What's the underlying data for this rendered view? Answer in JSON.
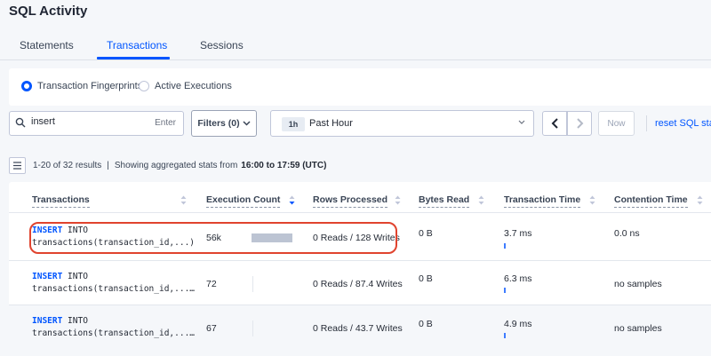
{
  "page": {
    "title": "SQL Activity"
  },
  "tabs": [
    {
      "label": "Statements",
      "active": false
    },
    {
      "label": "Transactions",
      "active": true
    },
    {
      "label": "Sessions",
      "active": false
    }
  ],
  "view_options": [
    {
      "label": "Transaction Fingerprints",
      "selected": true
    },
    {
      "label": "Active Executions",
      "selected": false
    }
  ],
  "search": {
    "value": "insert",
    "enter_label": "Enter"
  },
  "filters": {
    "label": "Filters (0)"
  },
  "time_range": {
    "badge": "1h",
    "label": "Past Hour"
  },
  "nav": {
    "now_label": "Now",
    "reset_label": "reset SQL stats"
  },
  "results": {
    "count_text": "1-20 of 32 results",
    "separator": "|",
    "prefix": "Showing aggregated stats from",
    "range": "16:00 to 17:59 (UTC)"
  },
  "table": {
    "columns": [
      "Transactions",
      "Execution Count",
      "Rows Processed",
      "Bytes Read",
      "Transaction Time",
      "Contention Time"
    ],
    "rows": [
      {
        "keyword": "INSERT",
        "after_keyword": " INTO",
        "line2": "transactions(transaction_id,...)",
        "exec_count": "56k",
        "exec_fraction": 1.0,
        "rows_processed": "0 Reads / 128 Writes",
        "bytes_read": "0 B",
        "txn_time": "3.7 ms",
        "contention": "0.0 ns"
      },
      {
        "keyword": "INSERT",
        "after_keyword": " INTO",
        "line2": "transactions(transaction_id,...…",
        "exec_count": "72",
        "exec_fraction": 0.0,
        "rows_processed": "0 Reads / 87.4 Writes",
        "bytes_read": "0 B",
        "txn_time": "6.3 ms",
        "contention": "no samples"
      },
      {
        "keyword": "INSERT",
        "after_keyword": " INTO",
        "line2": "transactions(transaction_id,...…",
        "exec_count": "67",
        "exec_fraction": 0.0,
        "rows_processed": "0 Reads / 43.7 Writes",
        "bytes_read": "0 B",
        "txn_time": "4.9 ms",
        "contention": "no samples"
      }
    ]
  },
  "icons": {
    "search": "search-icon",
    "chevron": "chevron-down-icon",
    "prev": "chevron-left-icon",
    "next": "chevron-right-icon",
    "columns": "column-selector-icon",
    "sort": "sort-icon"
  },
  "colors": {
    "accent": "#0055ff",
    "highlight": "#e0432e"
  }
}
